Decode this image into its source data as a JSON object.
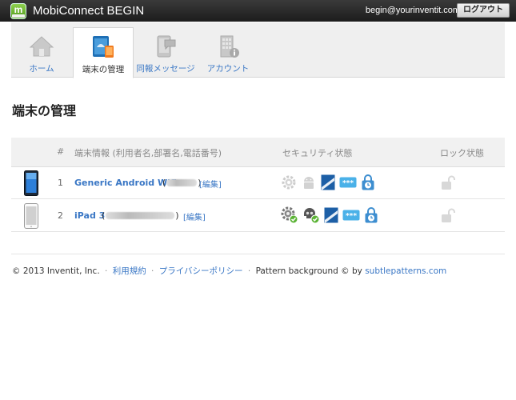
{
  "header": {
    "app_title": "MobiConnect BEGIN",
    "user_email": "begin@yourinventit.com",
    "logout_label": "ログアウト",
    "logo_icon": "mobiconnect-logo"
  },
  "nav": {
    "tabs": [
      {
        "label": "ホーム",
        "icon": "home-icon",
        "active": false
      },
      {
        "label": "端末の管理",
        "icon": "device-management-icon",
        "active": true
      },
      {
        "label": "同報メッセージ",
        "icon": "broadcast-message-icon",
        "active": false
      },
      {
        "label": "アカウント",
        "icon": "account-building-icon",
        "active": false
      }
    ]
  },
  "page": {
    "title": "端末の管理"
  },
  "table": {
    "columns": {
      "num": "#",
      "info": "端末情報 (利用者名,部署名,電話番号)",
      "security": "セキュリティ状態",
      "lock": "ロック状態"
    },
    "rows": [
      {
        "num": "1",
        "name": "Generic Android Wifi",
        "device_type": "android-tablet",
        "owner_open": "(",
        "owner_close": ")",
        "edit_label": "[編集]"
      },
      {
        "num": "2",
        "name": "iPad 3",
        "device_type": "ipad",
        "owner_open": "(",
        "owner_close": ")",
        "edit_label": "[編集]"
      }
    ]
  },
  "footer": {
    "copyright": "© 2013 Inventit, Inc.",
    "sep1": "·",
    "terms": "利用規約",
    "sep2": "·",
    "privacy": "プライバシーポリシー",
    "sep3": "·",
    "pattern_text": "Pattern background © by",
    "pattern_link": "subtlepatterns.com"
  },
  "colors": {
    "link": "#3a77c5",
    "topbar": "#262626",
    "accent_green": "#6abf2e"
  }
}
